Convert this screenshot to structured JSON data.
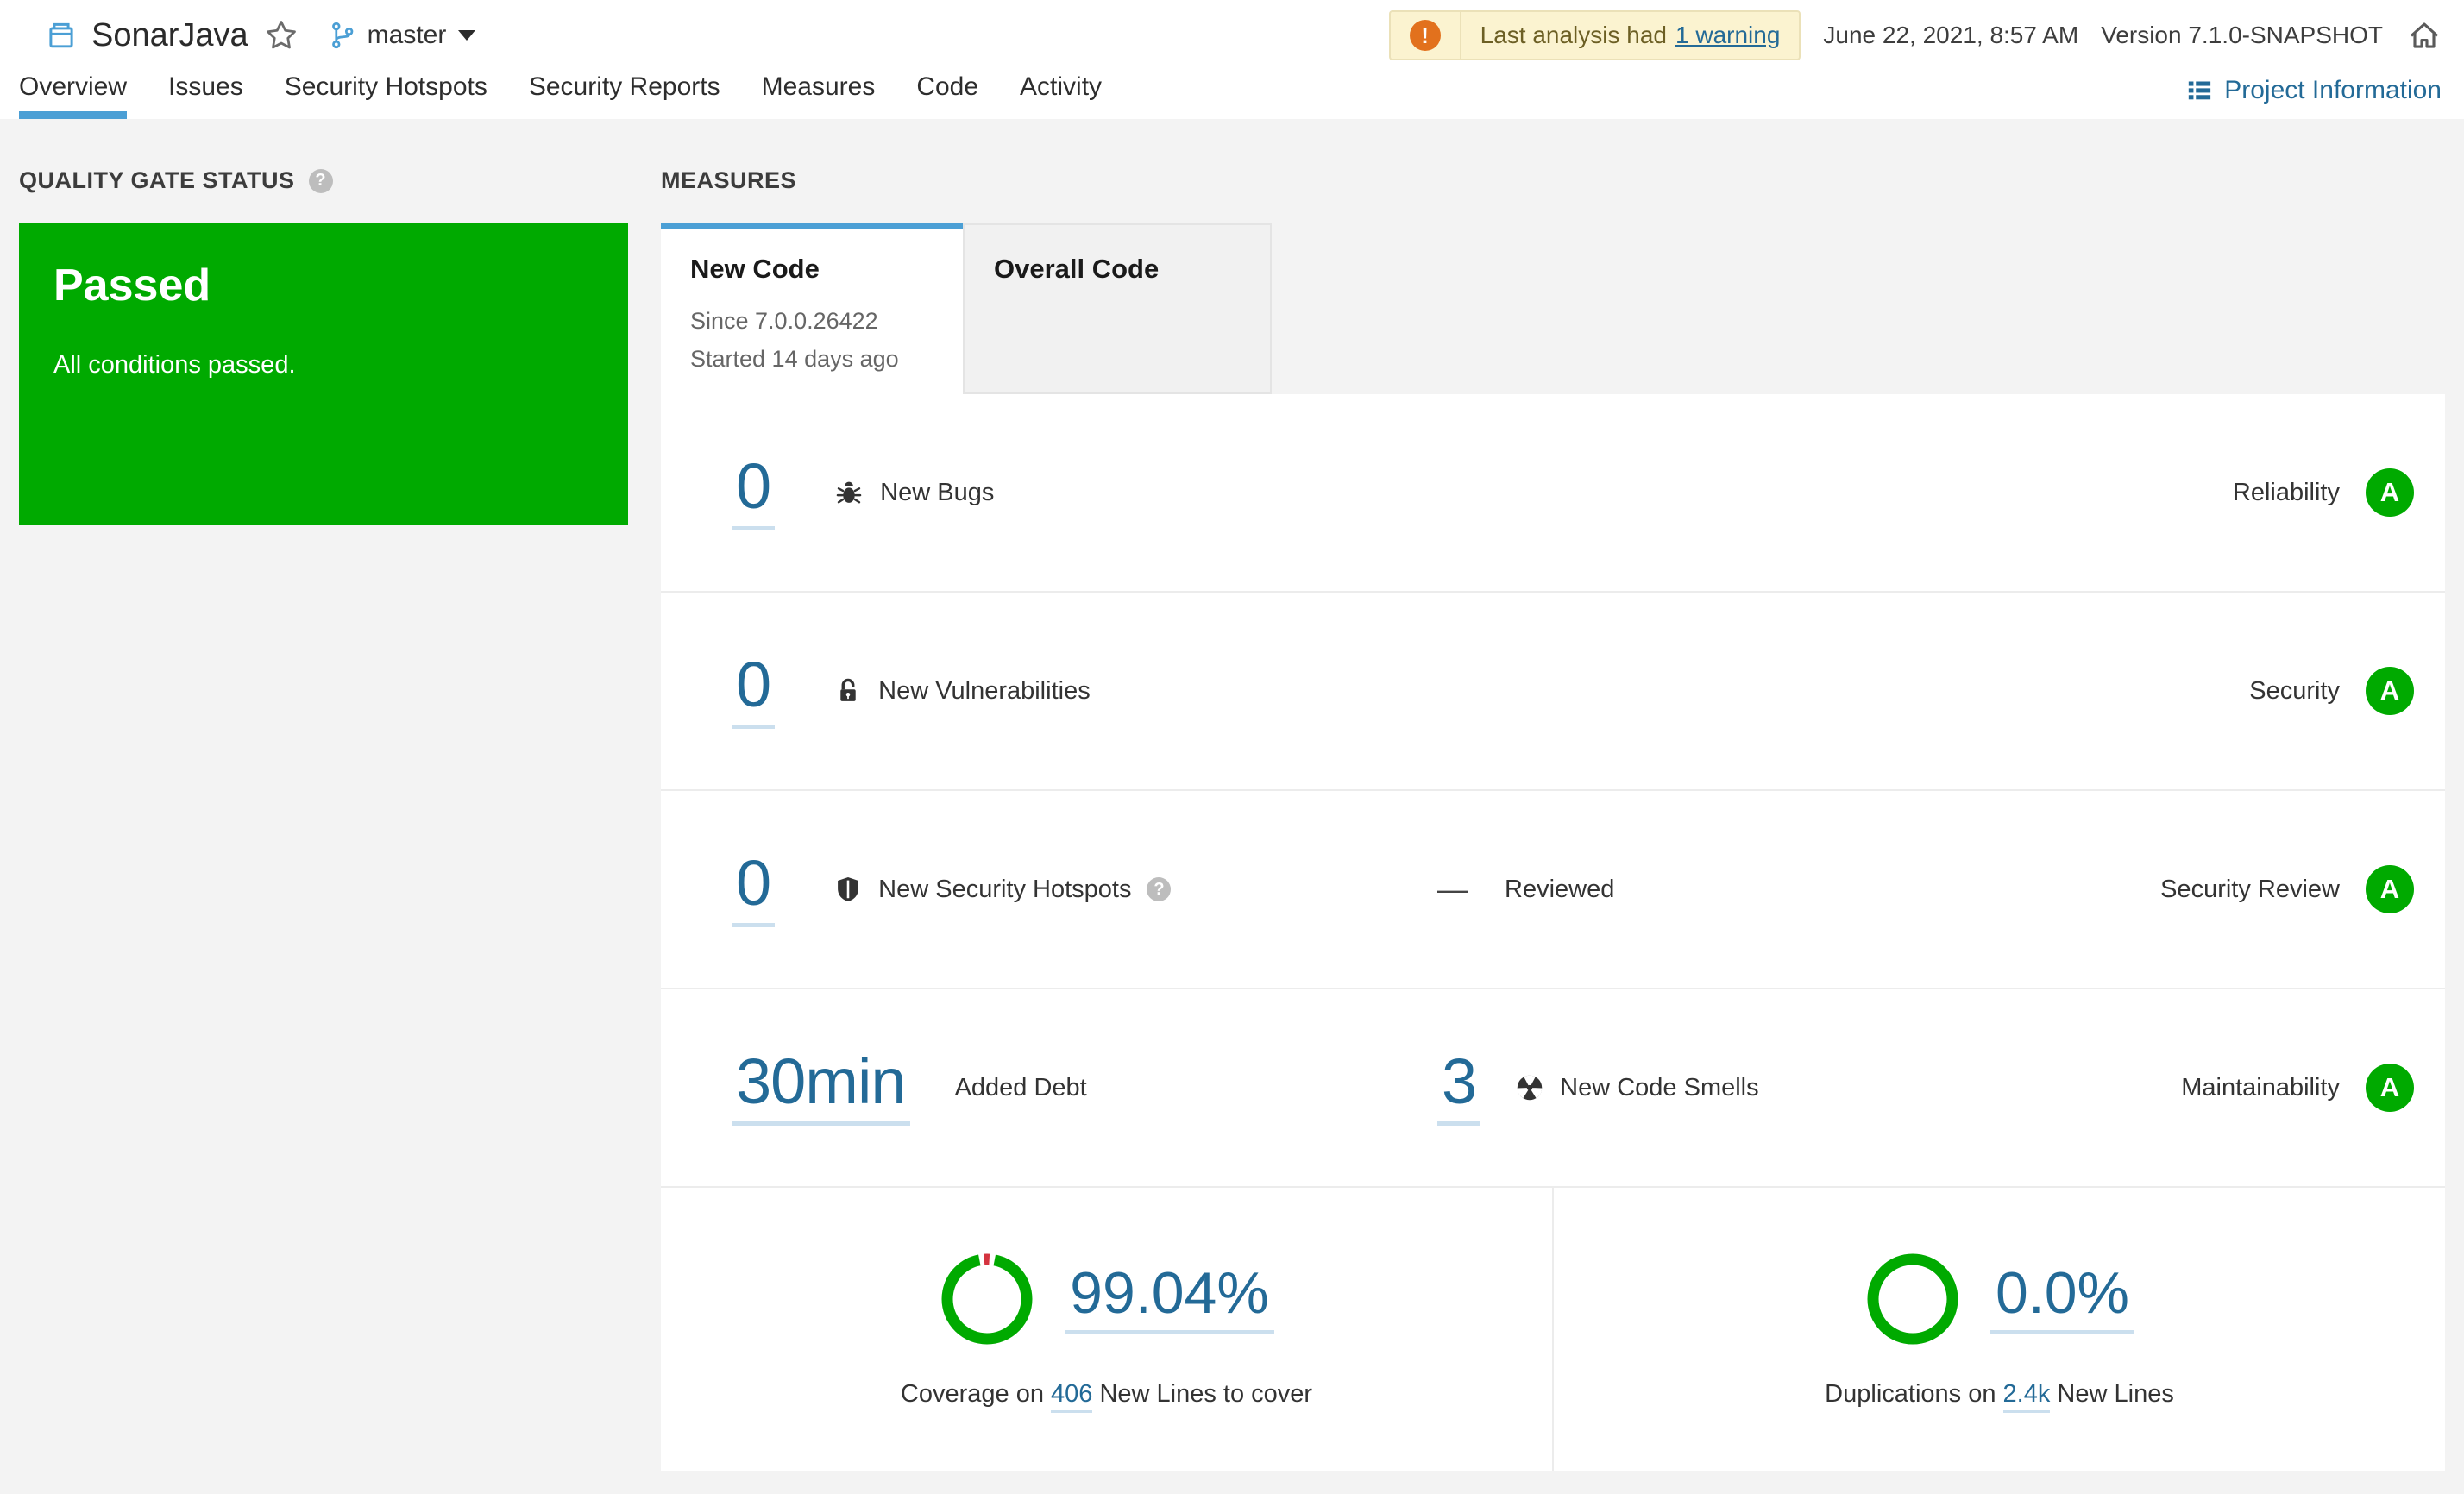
{
  "header": {
    "project_name": "SonarJava",
    "branch": "master",
    "warning_banner": {
      "icon_glyph": "!",
      "text": "Last analysis had",
      "link_label": "1 warning"
    },
    "analysis_date": "June 22, 2021, 8:57 AM",
    "version": "Version 7.1.0-SNAPSHOT"
  },
  "nav": {
    "tabs": [
      {
        "label": "Overview"
      },
      {
        "label": "Issues"
      },
      {
        "label": "Security Hotspots"
      },
      {
        "label": "Security Reports"
      },
      {
        "label": "Measures"
      },
      {
        "label": "Code"
      },
      {
        "label": "Activity"
      }
    ],
    "active_tab": "Overview",
    "project_information": "Project Information"
  },
  "quality_gate": {
    "heading": "QUALITY GATE STATUS",
    "help_glyph": "?",
    "status": "Passed",
    "description": "All conditions passed."
  },
  "measures": {
    "heading": "MEASURES",
    "tabs": {
      "new_code": {
        "label": "New Code",
        "since": "Since 7.0.0.26422",
        "started": "Started 14 days ago"
      },
      "overall_code": {
        "label": "Overall Code"
      }
    },
    "rows": [
      {
        "value": "0",
        "label": "New Bugs",
        "domain": "Reliability",
        "rating": "A"
      },
      {
        "value": "0",
        "label": "New Vulnerabilities",
        "domain": "Security",
        "rating": "A"
      },
      {
        "value": "0",
        "label": "New Security Hotspots",
        "help_glyph": "?",
        "reviewed_dash": "—",
        "reviewed_label": "Reviewed",
        "domain": "Security Review",
        "rating": "A"
      },
      {
        "value": "30min",
        "label": "Added Debt",
        "value2": "3",
        "label2": "New Code Smells",
        "domain": "Maintainability",
        "rating": "A"
      }
    ],
    "coverage": {
      "percent": "99.04%",
      "caption_prefix": "Coverage on",
      "lines": "406",
      "caption_suffix": "New Lines to cover"
    },
    "duplications": {
      "percent": "0.0%",
      "caption_prefix": "Duplications on",
      "lines": "2.4k",
      "caption_suffix": "New Lines"
    }
  },
  "colors": {
    "link_blue": "#236a97",
    "accent_blue": "#4b9fd5",
    "success_green": "#00aa00",
    "warning_orange": "#e2711d",
    "uncovered_red": "#d4333f"
  }
}
